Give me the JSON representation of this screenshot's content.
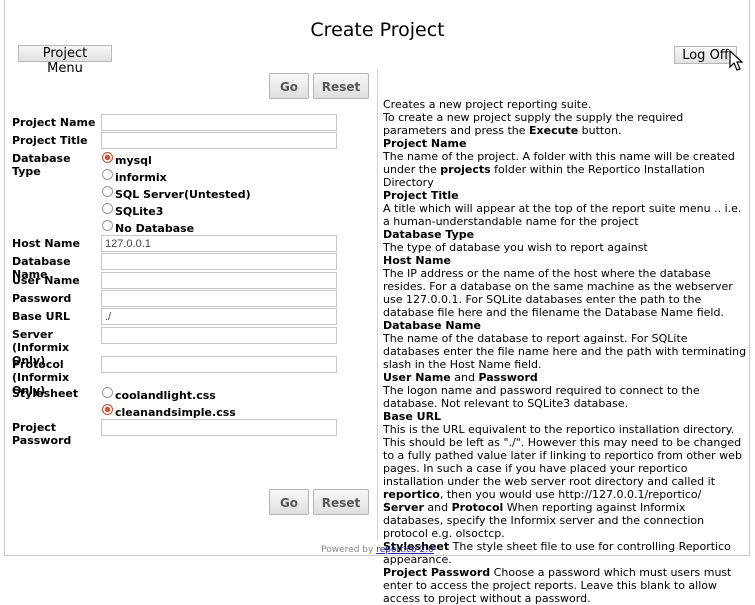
{
  "page": {
    "title": "Create Project"
  },
  "header": {
    "project_menu_label": "Project Menu",
    "log_off_label": "Log Off"
  },
  "actions": {
    "go_label": "Go",
    "reset_label": "Reset"
  },
  "form": {
    "project_name": {
      "label": "Project Name",
      "value": ""
    },
    "project_title": {
      "label": "Project Title",
      "value": ""
    },
    "database_type": {
      "label": "Database Type",
      "options": [
        "mysql",
        "informix",
        "SQL Server(Untested)",
        "SQLite3",
        "No Database"
      ],
      "selected": "mysql"
    },
    "host_name": {
      "label": "Host Name",
      "value": "127.0.0.1"
    },
    "database_name": {
      "label": "Database Name",
      "value": ""
    },
    "user_name": {
      "label": "User Name",
      "value": ""
    },
    "password": {
      "label": "Password",
      "value": ""
    },
    "base_url": {
      "label": "Base URL",
      "value": "./"
    },
    "server": {
      "label_line1": "Server (Informix",
      "label_line2": "Only)",
      "value": ""
    },
    "protocol": {
      "label_line1": "Protocol",
      "label_line2": "(Informix Only)",
      "value": ""
    },
    "stylesheet": {
      "label": "Stylesheet",
      "options": [
        "coolandlight.css",
        "cleanandsimple.css"
      ],
      "selected": "cleanandsimple.css"
    },
    "project_password": {
      "label_line1": "Project",
      "label_line2": "Password",
      "value": ""
    }
  },
  "help": {
    "intro1": "Creates a new project reporting suite.",
    "intro2a": "To create a new project supply the supply the required parameters and press the ",
    "intro2b": "Execute",
    "intro2c": " button.",
    "pn_h": "Project Name",
    "pn_a": "The name of the project. A folder with this name will be created under the ",
    "pn_b": "projects",
    "pn_c": " folder within the Reportico Installation Directory",
    "pt_h": "Project Title",
    "pt_t": "A title which will appear at the top of the report suite menu .. i.e. a human-understandable name for the project",
    "dt_h": "Database Type",
    "dt_t": "The type of database you wish to report against",
    "hn_h": "Host Name",
    "hn_t": "The IP address or the name of the host where the database resides. For a database on the same machine as the webserver use 127.0.0.1. For SQLite databases enter the path to the database file here and the filename the Database Name field.",
    "dn_h": "Database Name",
    "dn_t": "The name of the database to report against. For SQLite databases enter the file name here and the path with terminating slash in the Host Name field.",
    "up_h1": "User Name",
    "up_and": " and ",
    "up_h2": "Password",
    "up_t": "The logon name and password required to connect to the database. Not relevant to SQLite3 database.",
    "bu_h": "Base URL",
    "bu_a": "This is the URL equivalent to the reportico installation directory. This should be left as \"./\". However this may need to be changed to a fully pathed value later if linking to reportico from other web pages. In such a case if you have placed your reportico installation under the web server root directory and called it ",
    "bu_b": "reportico",
    "bu_c": ", then you would use http://127.0.0.1/reportico/",
    "sp_h1": "Server",
    "sp_and": " and ",
    "sp_h2": "Protocol",
    "sp_t": " When reporting against Informix databases, specify the Informix server and the connection protocol e.g. olsoctcp.",
    "ss_h": "Stylesheet",
    "ss_t": " The style sheet file to use for controlling Reportico appearance.",
    "pp_h": "Project Password",
    "pp_t": " Choose a password which must users must enter to access the project reports. Leave this blank to allow access to project without a password."
  },
  "footer": {
    "powered_by": "Powered by ",
    "link": "reportico 2.0"
  }
}
